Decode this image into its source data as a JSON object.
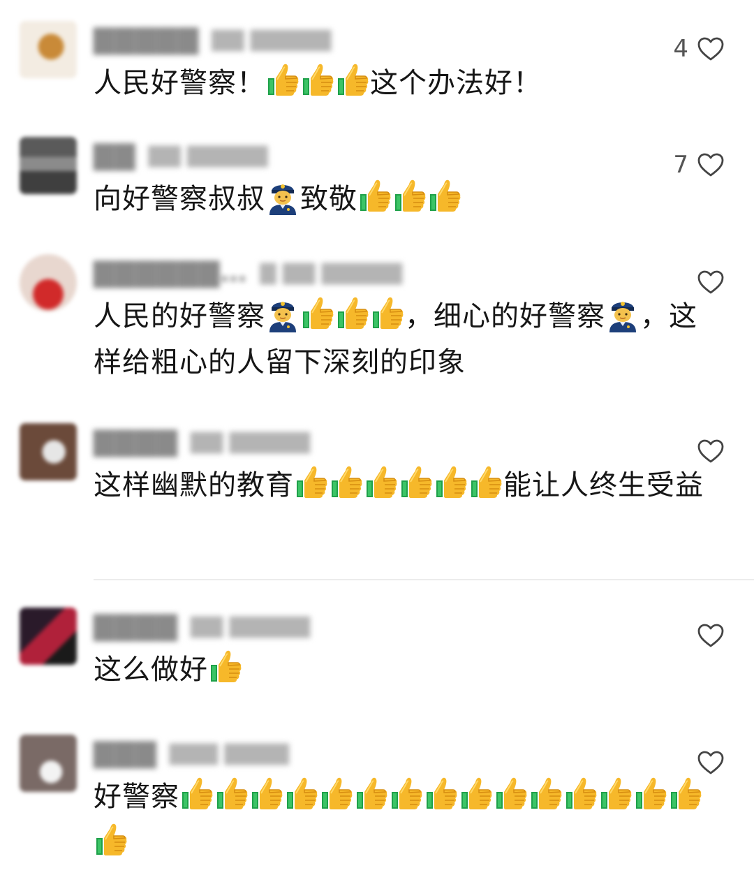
{
  "colors": {
    "text": "#161616",
    "muted": "#8a8a8a",
    "thumb_yellow": "#f6b82a",
    "thumb_green": "#1fa14a",
    "police_blue": "#1d3f7a"
  },
  "icons": {
    "like": "heart-outline-icon",
    "thumbs_up": "thumbs-up-emoji",
    "police": "police-officer-emoji"
  },
  "comments": [
    {
      "text_before": "人民好警察！",
      "emoji1": "thumbs-up-emoji",
      "emoji2": "thumbs-up-emoji",
      "emoji3": "thumbs-up-emoji",
      "text_after": "这个办法好！",
      "likes": "4"
    },
    {
      "text_before": "向好警察叔叔",
      "police_emoji": "police-officer-emoji",
      "text_mid": "致敬",
      "emoji1": "thumbs-up-emoji",
      "emoji2": "thumbs-up-emoji",
      "emoji3": "thumbs-up-emoji",
      "likes": "7"
    },
    {
      "text_before": "人民的好警察",
      "text_mid": "，细心的好警察",
      "text_after": "，这样给粗心的人留下深刻的印象",
      "likes": ""
    },
    {
      "text_before": "这样幽默的教育",
      "text_after": "能让人终生受益",
      "likes": ""
    },
    {
      "text_before": "这么做好",
      "likes": ""
    },
    {
      "text_before": "好警察",
      "likes": ""
    }
  ]
}
